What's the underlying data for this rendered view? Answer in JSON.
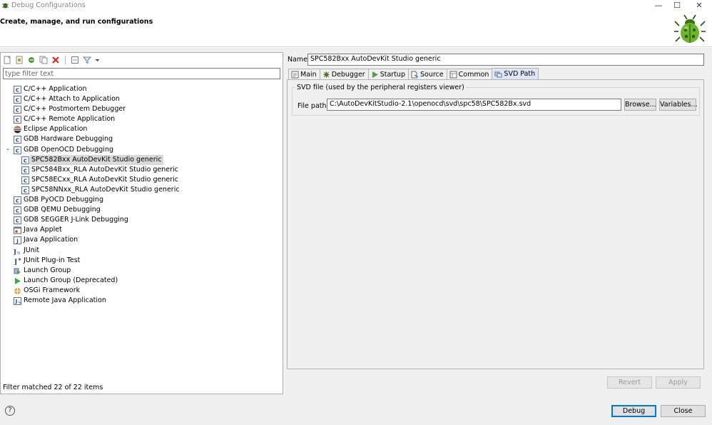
{
  "window": {
    "title": "Debug Configurations",
    "controls": {
      "minimize": "—",
      "maximize": "☐",
      "close": "✕"
    }
  },
  "banner": {
    "title": "Create, manage, and run configurations"
  },
  "filter": {
    "placeholder": "type filter text",
    "status": "Filter matched 22 of 22 items"
  },
  "tree": [
    {
      "label": "C/C++ Application",
      "icon": "c-app-icon",
      "level": 0
    },
    {
      "label": "C/C++ Attach to Application",
      "icon": "c-app-icon",
      "level": 0
    },
    {
      "label": "C/C++ Postmortem Debugger",
      "icon": "c-app-icon",
      "level": 0
    },
    {
      "label": "C/C++ Remote Application",
      "icon": "c-app-icon",
      "level": 0
    },
    {
      "label": "Eclipse Application",
      "icon": "eclipse-icon",
      "level": 0
    },
    {
      "label": "GDB Hardware Debugging",
      "icon": "c-app-icon",
      "level": 0
    },
    {
      "label": "GDB OpenOCD Debugging",
      "icon": "c-app-icon",
      "level": 0,
      "expanded": true
    },
    {
      "label": "SPC582Bxx AutoDevKit Studio generic",
      "icon": "c-app-icon",
      "level": 1,
      "selected": true
    },
    {
      "label": "SPC584Bxx_RLA AutoDevKit Studio generic",
      "icon": "c-app-icon",
      "level": 1
    },
    {
      "label": "SPC58ECxx_RLA AutoDevKit Studio generic",
      "icon": "c-app-icon",
      "level": 1
    },
    {
      "label": "SPC58NNxx_RLA AutoDevKit Studio generic",
      "icon": "c-app-icon",
      "level": 1
    },
    {
      "label": "GDB PyOCD Debugging",
      "icon": "c-app-icon",
      "level": 0
    },
    {
      "label": "GDB QEMU Debugging",
      "icon": "c-app-icon",
      "level": 0
    },
    {
      "label": "GDB SEGGER J-Link Debugging",
      "icon": "c-app-icon",
      "level": 0
    },
    {
      "label": "Java Applet",
      "icon": "java-applet-icon",
      "level": 0
    },
    {
      "label": "Java Application",
      "icon": "java-app-icon",
      "level": 0
    },
    {
      "label": "JUnit",
      "icon": "junit-icon",
      "level": 0
    },
    {
      "label": "JUnit Plug-in Test",
      "icon": "junit-plugin-icon",
      "level": 0
    },
    {
      "label": "Launch Group",
      "icon": "launch-group-icon",
      "level": 0
    },
    {
      "label": "Launch Group (Deprecated)",
      "icon": "launch-deprecated-icon",
      "level": 0
    },
    {
      "label": "OSGi Framework",
      "icon": "osgi-icon",
      "level": 0
    },
    {
      "label": "Remote Java Application",
      "icon": "remote-java-icon",
      "level": 0
    }
  ],
  "config": {
    "name_label": "Name:",
    "name_value": "SPC582Bxx AutoDevKit Studio generic",
    "tabs": [
      {
        "label": "Main",
        "icon": "main-tab-icon"
      },
      {
        "label": "Debugger",
        "icon": "debugger-tab-icon"
      },
      {
        "label": "Startup",
        "icon": "startup-tab-icon"
      },
      {
        "label": "Source",
        "icon": "source-tab-icon"
      },
      {
        "label": "Common",
        "icon": "common-tab-icon"
      },
      {
        "label": "SVD Path",
        "icon": "svd-tab-icon",
        "active": true
      }
    ],
    "svd_group_title": "SVD file (used by the peripheral registers viewer)",
    "file_path_label": "File path:",
    "file_path_value": "C:\\AutoDevKitStudio-2.1\\openocd\\svd\\spc58\\SPC582Bx.svd",
    "browse_label": "Browse...",
    "variables_label": "Variables...",
    "revert_label": "Revert",
    "apply_label": "Apply"
  },
  "footer": {
    "help": "?",
    "debug_label": "Debug",
    "close_label": "Close"
  },
  "colors": {
    "selection": "#d9d9d9",
    "active_tab": "#dce6f4",
    "default_button_border": "#0078d7"
  }
}
